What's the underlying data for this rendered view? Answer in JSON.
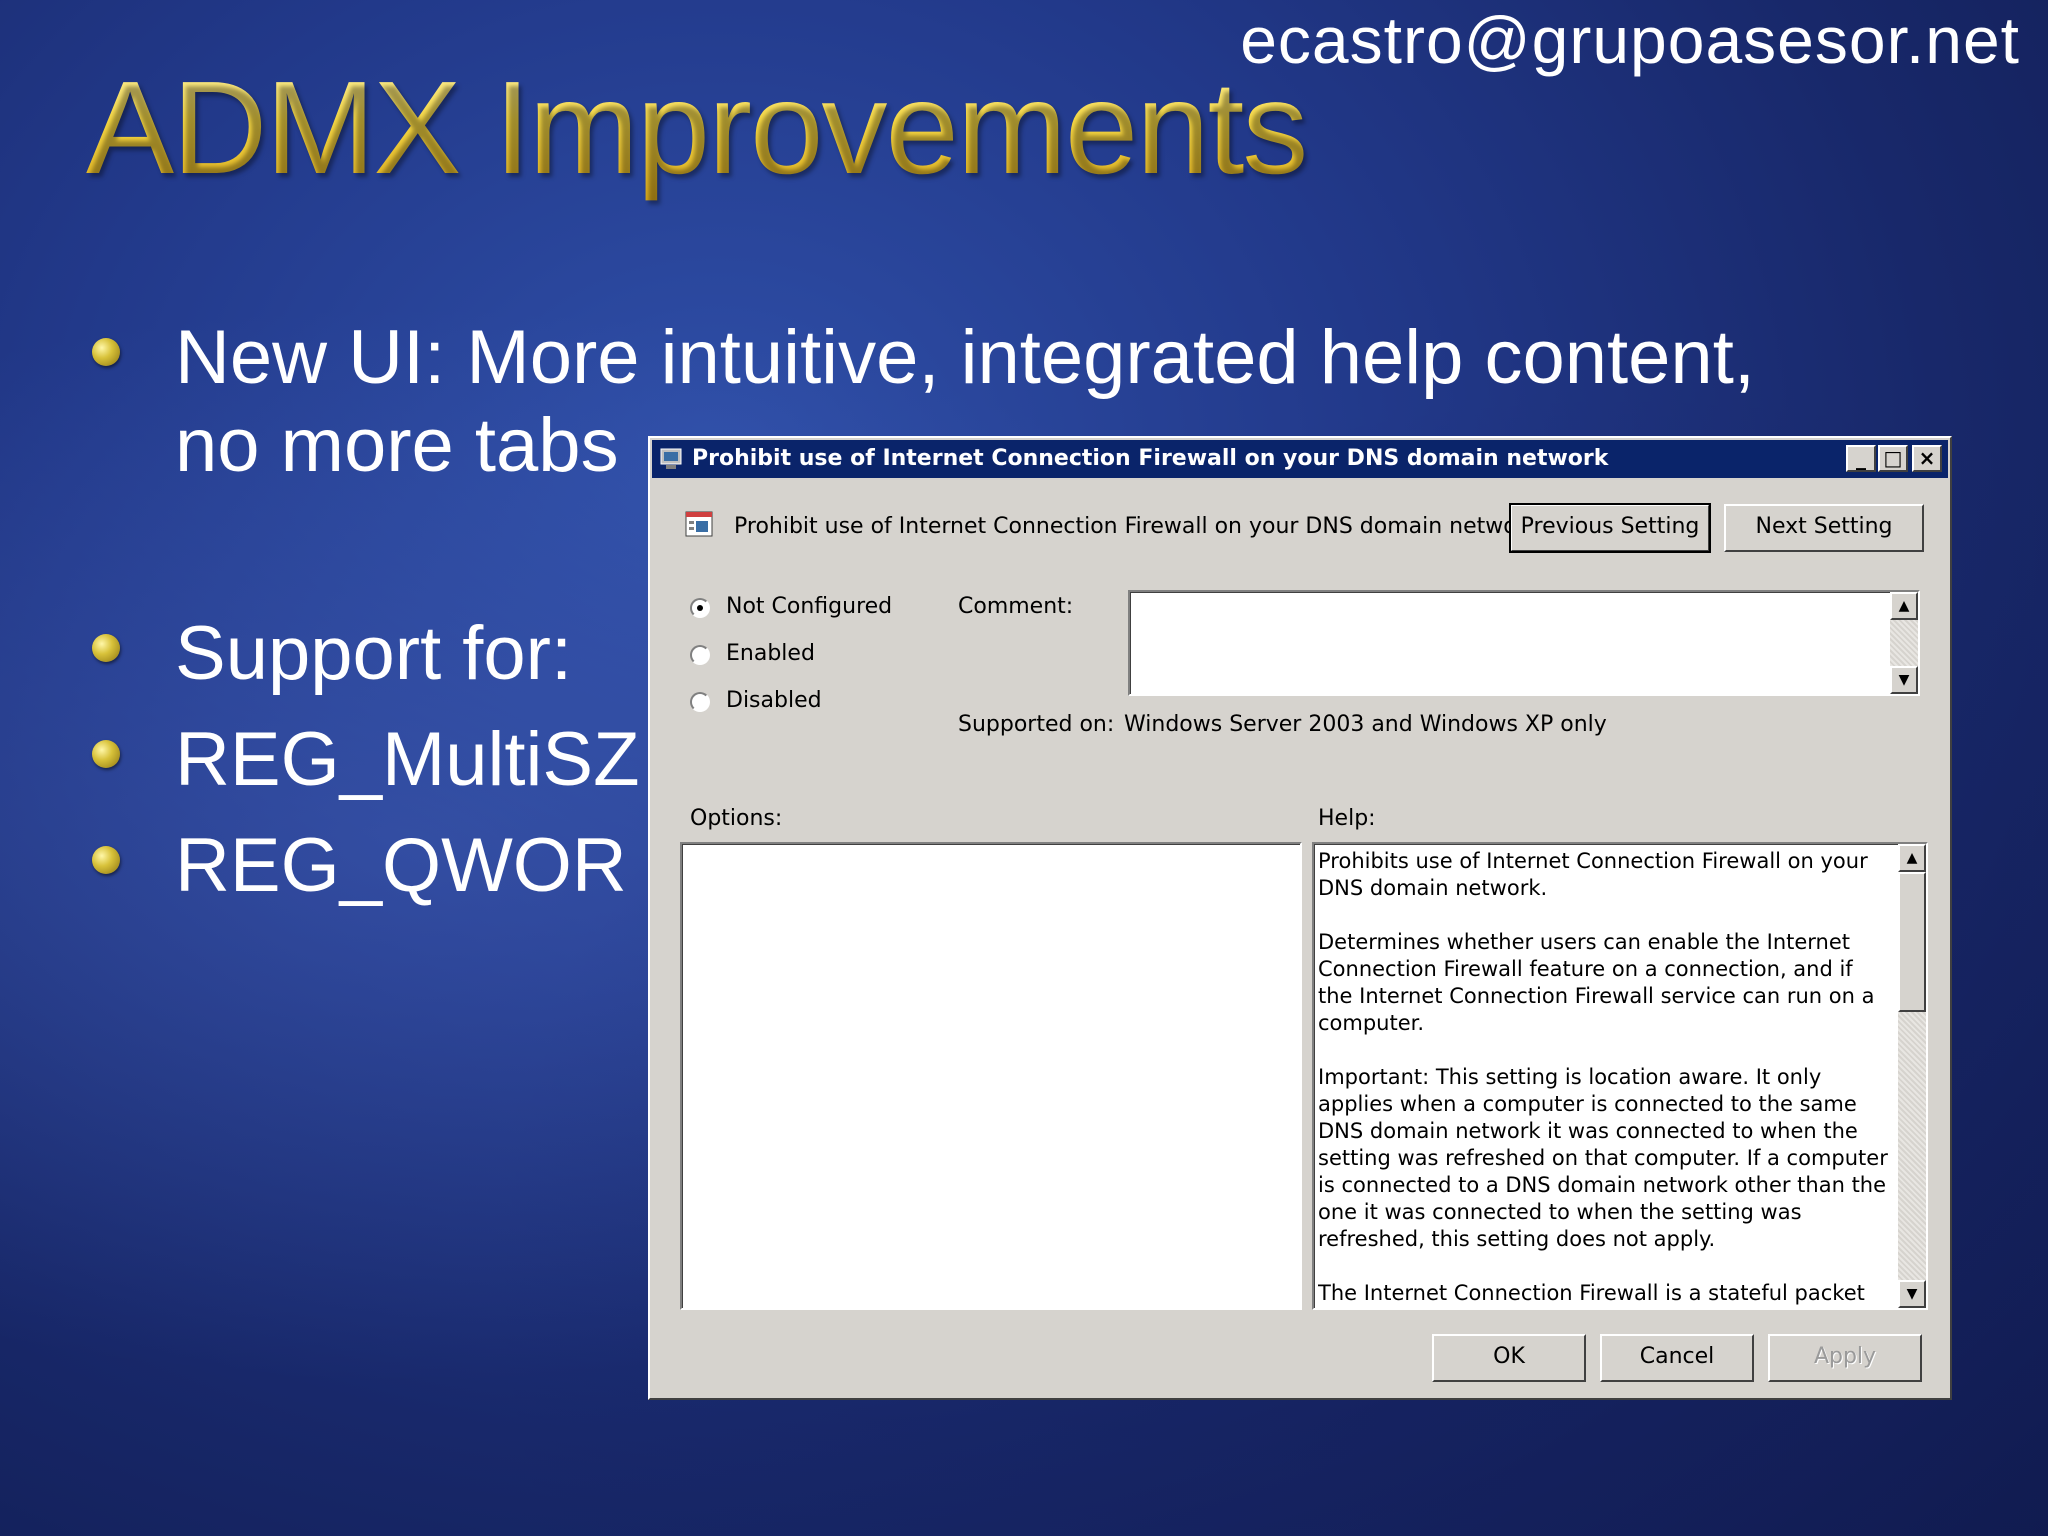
{
  "slide": {
    "email": "ecastro@grupoasesor.net",
    "title": "ADMX Improvements",
    "bullets": [
      "New UI: More intuitive, integrated help content,",
      "no more tabs",
      "Support for:",
      "REG_MultiSZ",
      "REG_QWOR"
    ]
  },
  "dialog": {
    "title": "Prohibit use of Internet Connection Firewall on your DNS domain network",
    "setting_name": "Prohibit use of Internet Connection Firewall on your DNS domain network",
    "previous_label": "Previous Setting",
    "next_label": "Next Setting",
    "radios": [
      "Not Configured",
      "Enabled",
      "Disabled"
    ],
    "selected_radio": "Not Configured",
    "comment_label": "Comment:",
    "comment_value": "",
    "supported_label": "Supported on:",
    "supported_value": "Windows Server 2003 and Windows XP only",
    "options_label": "Options:",
    "help_label": "Help:",
    "help_text": "Prohibits use of Internet Connection Firewall on your DNS domain network.\n\nDetermines whether users can enable the Internet Connection Firewall feature on a connection, and if the Internet Connection Firewall service can run on a computer.\n\nImportant: This setting is location aware. It only applies when a computer is connected to the same DNS domain network it was connected to when the setting was refreshed on that computer. If a computer is connected to a DNS domain network other than the one it was connected to when the setting was refreshed, this setting does not apply.\n\nThe Internet Connection Firewall is a stateful packet filter",
    "ok_label": "OK",
    "cancel_label": "Cancel",
    "apply_label": "Apply"
  },
  "colors": {
    "title_gold": "#f2d23a",
    "titlebar_blue": "#0a246a",
    "dialog_face": "#d6d3ce"
  }
}
